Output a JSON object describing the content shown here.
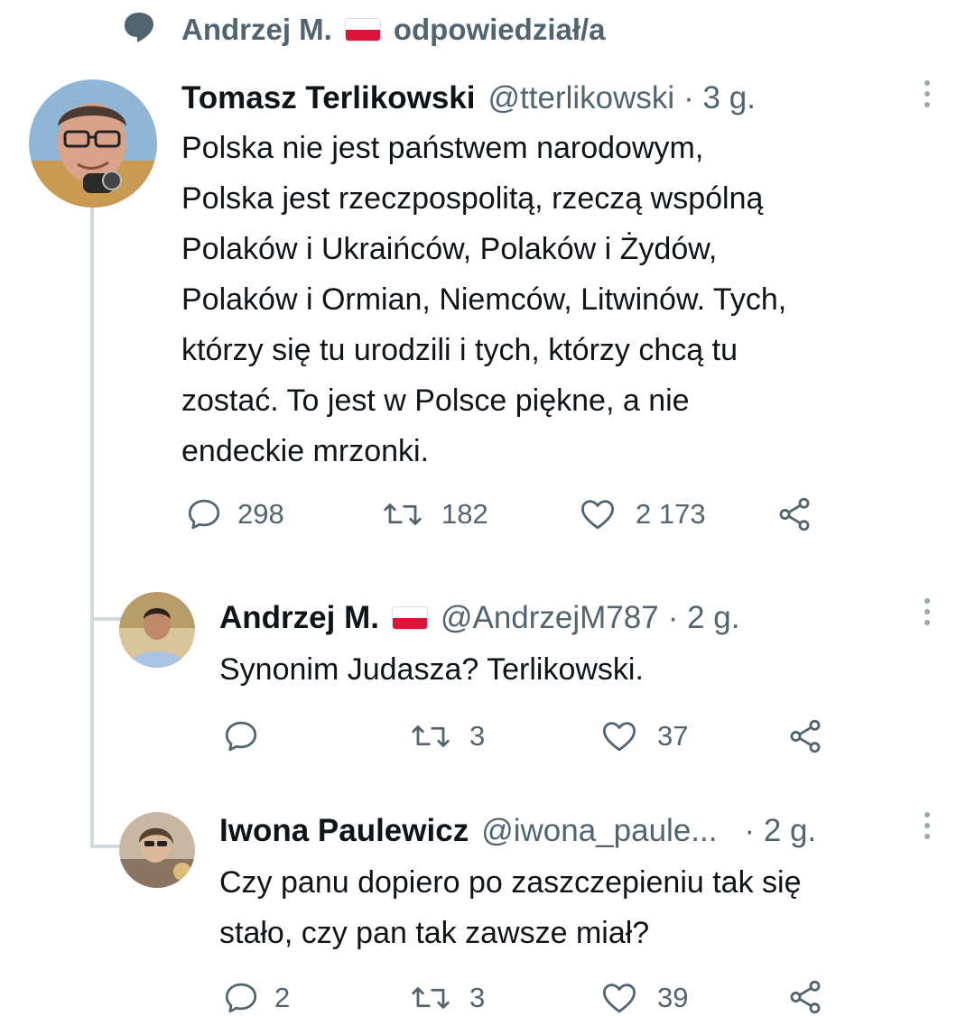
{
  "context": {
    "icon": "speech-bubble-icon",
    "name": "Andrzej M.",
    "action": "odpowiedział/a"
  },
  "colors": {
    "text": "#0f1419",
    "muted": "#536471",
    "thread_line": "#cfd9de",
    "flag_white": "#ffffff",
    "flag_red": "#dc143c"
  },
  "tweets": [
    {
      "name": "Tomasz Terlikowski",
      "handle": "@tterlikowski",
      "time": "· 3 g.",
      "text_lines": [
        "Polska nie jest państwem narodowym,",
        "Polska jest rzeczpospolitą, rzeczą wspólną",
        "Polaków i Ukraińców, Polaków i Żydów,",
        "Polaków i Ormian, Niemców, Litwinów. Tych,",
        "którzy się tu urodzili i tych, którzy chcą tu",
        "zostać. To jest w Polsce piękne, a nie",
        "endeckie mrzonki."
      ],
      "replies": "298",
      "retweets": "182",
      "likes": "2 173"
    },
    {
      "name": "Andrzej M.",
      "handle": "@AndrzejM787",
      "time": "· 2 g.",
      "text_lines": [
        "Synonim Judasza? Terlikowski."
      ],
      "replies": "",
      "retweets": "3",
      "likes": "37"
    },
    {
      "name": "Iwona Paulewicz",
      "handle": "@iwona_paule...",
      "time": "· 2 g.",
      "text_lines": [
        "Czy panu dopiero po zaszczepieniu tak się",
        "stało, czy pan tak zawsze miał?"
      ],
      "replies": "2",
      "retweets": "3",
      "likes": "39"
    }
  ]
}
